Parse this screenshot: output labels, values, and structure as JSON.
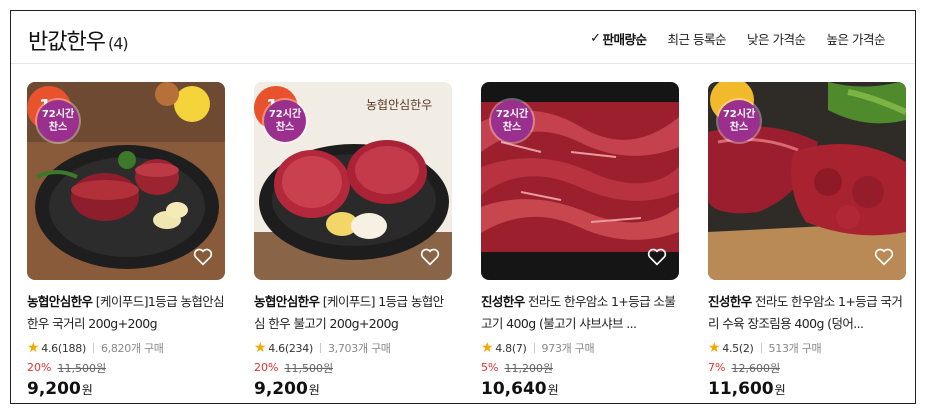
{
  "header": {
    "title": "반값한우",
    "count": "(4)",
    "sorts": [
      {
        "label": "판매량순",
        "active": true
      },
      {
        "label": "최근 등록순",
        "active": false
      },
      {
        "label": "낮은 가격순",
        "active": false
      },
      {
        "label": "높은 가격순",
        "active": false
      }
    ]
  },
  "badge": {
    "line1": "72시간",
    "line2": "찬스"
  },
  "cards": [
    {
      "brand": "농협안심한우",
      "title": " [케이푸드]1등급 농협안심 한우 국거리 200g+200g",
      "rating": "4.6(188)",
      "purchases": "6,820개 구매",
      "discount": "20%",
      "original_price": "11,500원",
      "price": "9,200",
      "currency": "원",
      "image": "beef-tenderloin-plate-icon"
    },
    {
      "brand": "농협안심한우",
      "title": " [케이푸드] 1등급 농협안심 한우 불고기 200g+200g",
      "rating": "4.6(234)",
      "purchases": "3,703개 구매",
      "discount": "20%",
      "original_price": "11,500원",
      "price": "9,200",
      "currency": "원",
      "image": "bulgogi-plate-icon",
      "image_text": "농협안심한우"
    },
    {
      "brand": "진성한우",
      "title": " 전라도 한우암소 1+등급 소불고기 400g (불고기 샤브샤브 ...",
      "rating": "4.8(7)",
      "purchases": "973개 구매",
      "discount": "5%",
      "original_price": "11,200원",
      "price": "10,640",
      "currency": "원",
      "image": "sliced-beef-icon"
    },
    {
      "brand": "진성한우",
      "title": " 전라도 한우암소 1+등급 국거리 수육 장조림용 400g (덩어...",
      "rating": "4.5(2)",
      "purchases": "513개 구매",
      "discount": "7%",
      "original_price": "12,600원",
      "price": "11,600",
      "currency": "원",
      "image": "beef-chunks-board-icon"
    }
  ],
  "colors": {
    "badge": "#9b2f8e",
    "discount": "#e8302c",
    "star": "#f6a800"
  }
}
